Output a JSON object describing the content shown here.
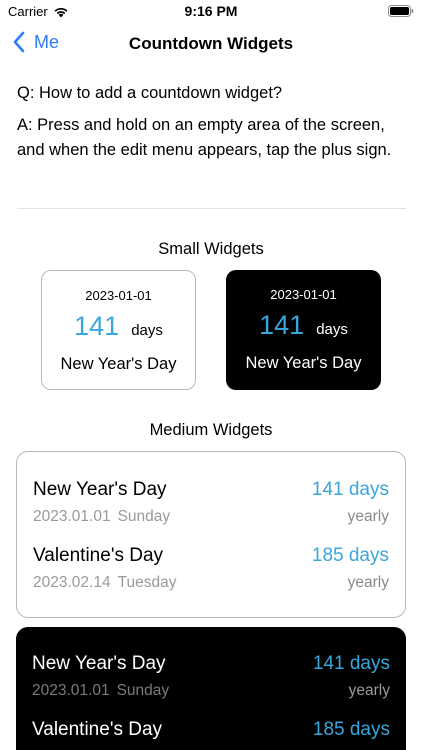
{
  "status_bar": {
    "carrier": "Carrier",
    "time": "9:16 PM"
  },
  "nav": {
    "back_label": "Me",
    "title": "Countdown Widgets"
  },
  "faq": {
    "question": "Q: How to add a countdown widget?",
    "answer": "A: Press and hold on an empty area of the screen, and when the edit menu appears, tap the plus sign."
  },
  "small_section_title": "Small Widgets",
  "small_widgets": [
    {
      "date": "2023-01-01",
      "count": "141",
      "unit": "days",
      "name": "New Year's Day",
      "theme": "light"
    },
    {
      "date": "2023-01-01",
      "count": "141",
      "unit": "days",
      "name": "New Year's Day",
      "theme": "dark"
    }
  ],
  "medium_section_title": "Medium Widgets",
  "medium_widgets": [
    {
      "theme": "light",
      "events": [
        {
          "name": "New Year's Day",
          "days": "141 days",
          "date": "2023.01.01",
          "weekday": "Sunday",
          "repeat": "yearly"
        },
        {
          "name": "Valentine's Day",
          "days": "185 days",
          "date": "2023.02.14",
          "weekday": "Tuesday",
          "repeat": "yearly"
        }
      ]
    },
    {
      "theme": "dark",
      "events": [
        {
          "name": "New Year's Day",
          "days": "141 days",
          "date": "2023.01.01",
          "weekday": "Sunday",
          "repeat": "yearly"
        },
        {
          "name": "Valentine's Day",
          "days": "185 days",
          "date": "",
          "weekday": "",
          "repeat": ""
        }
      ]
    }
  ],
  "colors": {
    "accent": "#3aa6dc",
    "link": "#2f7cf6"
  }
}
